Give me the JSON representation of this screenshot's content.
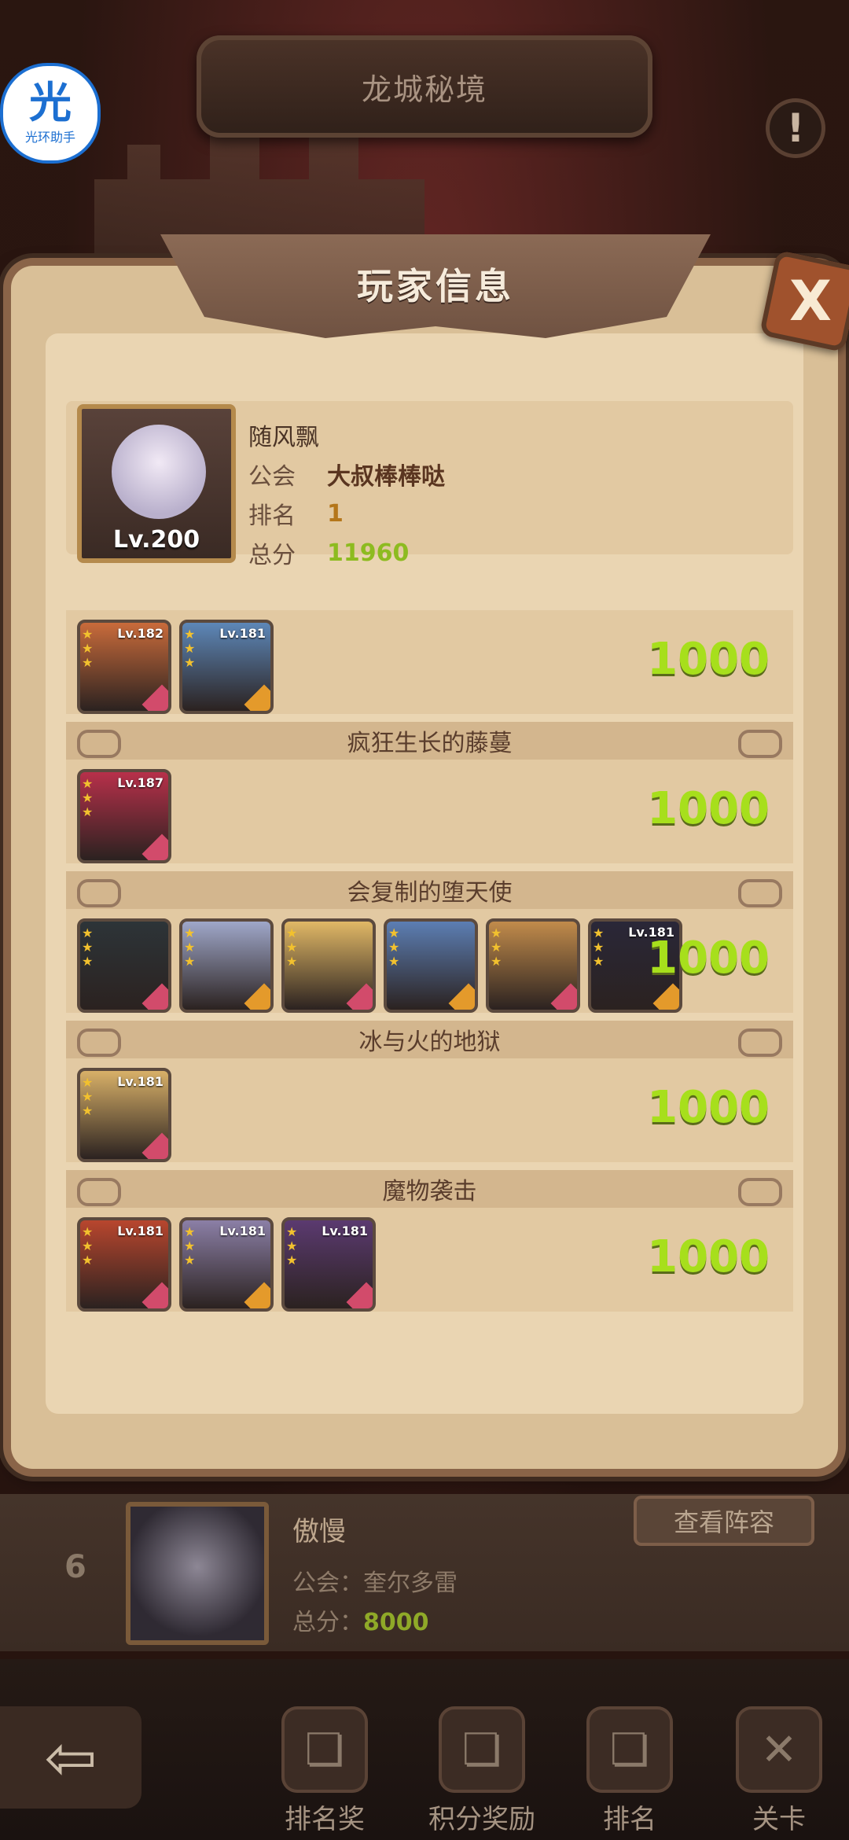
{
  "top": {
    "title": "龙城秘境",
    "logo_glyph": "光",
    "logo_text": "光环助手"
  },
  "panel": {
    "title": "玩家信息",
    "close_label": "X"
  },
  "player": {
    "name": "随风飘",
    "guild_label": "公会",
    "guild": "大叔棒棒哒",
    "rank_label": "排名",
    "rank": "1",
    "score_label": "总分",
    "score": "11960",
    "level": "Lv.200"
  },
  "sections": [
    {
      "title": "",
      "score": "1000",
      "heroes": [
        {
          "lv": "Lv.182",
          "color": "#c96b3b"
        },
        {
          "lv": "Lv.181",
          "color": "#5d87b8"
        }
      ]
    },
    {
      "title": "疯狂生长的藤蔓",
      "score": "1000",
      "heroes": [
        {
          "lv": "Lv.187",
          "color": "#b7304a"
        }
      ]
    },
    {
      "title": "会复制的堕天使",
      "score": "1000",
      "heroes": [
        {
          "lv": "",
          "color": "#2d3438"
        },
        {
          "lv": "",
          "color": "#9fa7c9"
        },
        {
          "lv": "",
          "color": "#e1b866"
        },
        {
          "lv": "",
          "color": "#5c7eb3"
        },
        {
          "lv": "",
          "color": "#c18b4b"
        },
        {
          "lv": "Lv.181",
          "color": "#2a2738"
        }
      ]
    },
    {
      "title": "冰与火的地狱",
      "score": "1000",
      "heroes": [
        {
          "lv": "Lv.181",
          "color": "#d8b068"
        }
      ]
    },
    {
      "title": "魔物袭击",
      "score": "1000",
      "heroes": [
        {
          "lv": "Lv.181",
          "color": "#b8462e"
        },
        {
          "lv": "Lv.181",
          "color": "#8b7fa6"
        },
        {
          "lv": "Lv.181",
          "color": "#5b3a70"
        }
      ]
    }
  ],
  "entry": {
    "rank": "6",
    "name": "傲慢",
    "guild_text": "公会：奎尔多雷",
    "score_label": "总分：",
    "score": "8000",
    "view_button": "查看阵容"
  },
  "nav": {
    "back_label": "⇦",
    "items": [
      {
        "label": "排名奖"
      },
      {
        "label": "积分奖励"
      },
      {
        "label": "排名"
      },
      {
        "label": "关卡"
      }
    ]
  }
}
